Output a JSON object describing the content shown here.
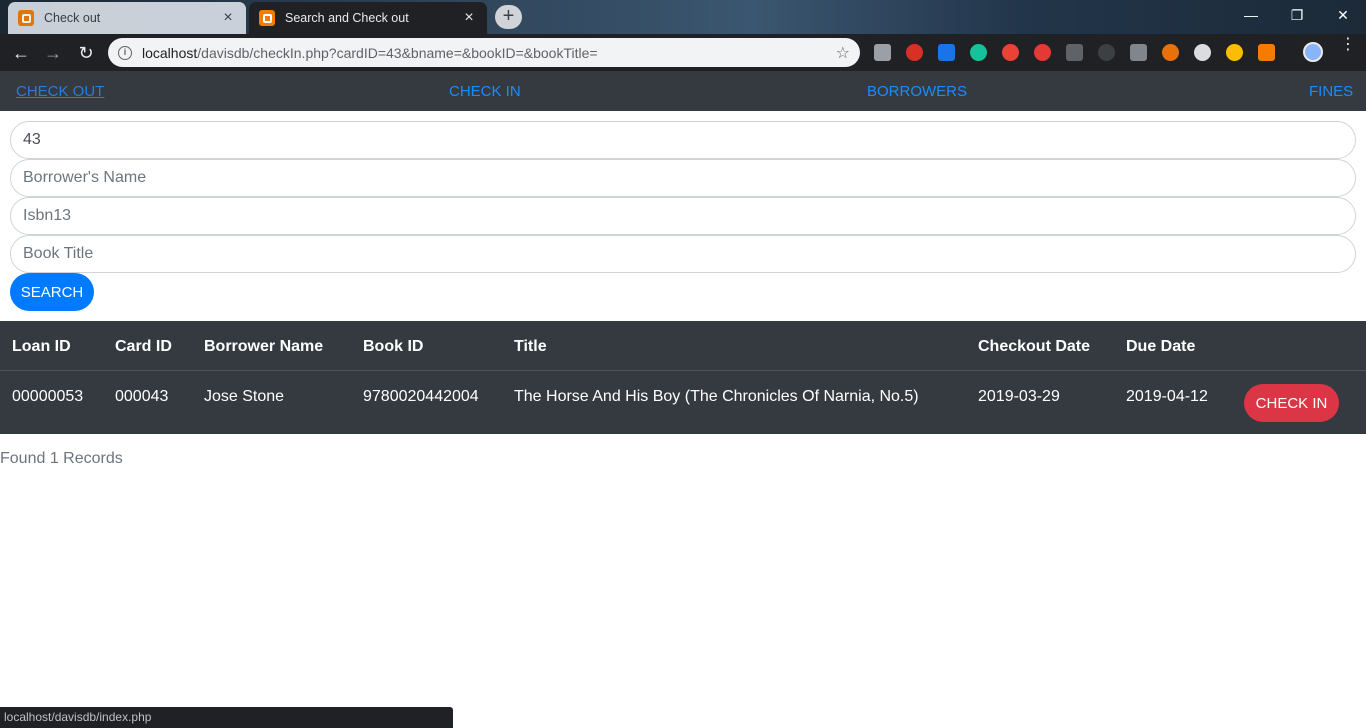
{
  "browser": {
    "tabs": [
      {
        "title": "Check out",
        "active": false
      },
      {
        "title": "Search and Check out",
        "active": true
      }
    ],
    "url_host": "localhost",
    "url_path": "/davisdb/checkIn.php?cardID=43&bname=&bookID=&bookTitle=",
    "status_url": "localhost/davisdb/index.php"
  },
  "nav": {
    "check_out": "CHECK OUT",
    "check_in": "CHECK IN",
    "borrowers": "BORROWERS",
    "fines": "FINES"
  },
  "form": {
    "card_id_value": "43",
    "borrower_placeholder": "Borrower's Name",
    "isbn_placeholder": "Isbn13",
    "title_placeholder": "Book Title",
    "search_label": "SEARCH"
  },
  "table": {
    "headers": [
      "Loan ID",
      "Card ID",
      "Borrower Name",
      "Book ID",
      "Title",
      "Checkout Date",
      "Due Date"
    ],
    "rows": [
      {
        "loan_id": "00000053",
        "card_id": "000043",
        "borrower_name": "Jose Stone",
        "book_id": "9780020442004",
        "title": "The Horse And His Boy (The Chronicles Of Narnia, No.5)",
        "checkout_date": "2019-03-29",
        "due_date": "2019-04-12",
        "action_label": "CHECK IN"
      }
    ]
  },
  "found_text": "Found 1 Records",
  "colors": {
    "primary": "#007bff",
    "danger": "#dc3545",
    "dark": "#343a40"
  }
}
